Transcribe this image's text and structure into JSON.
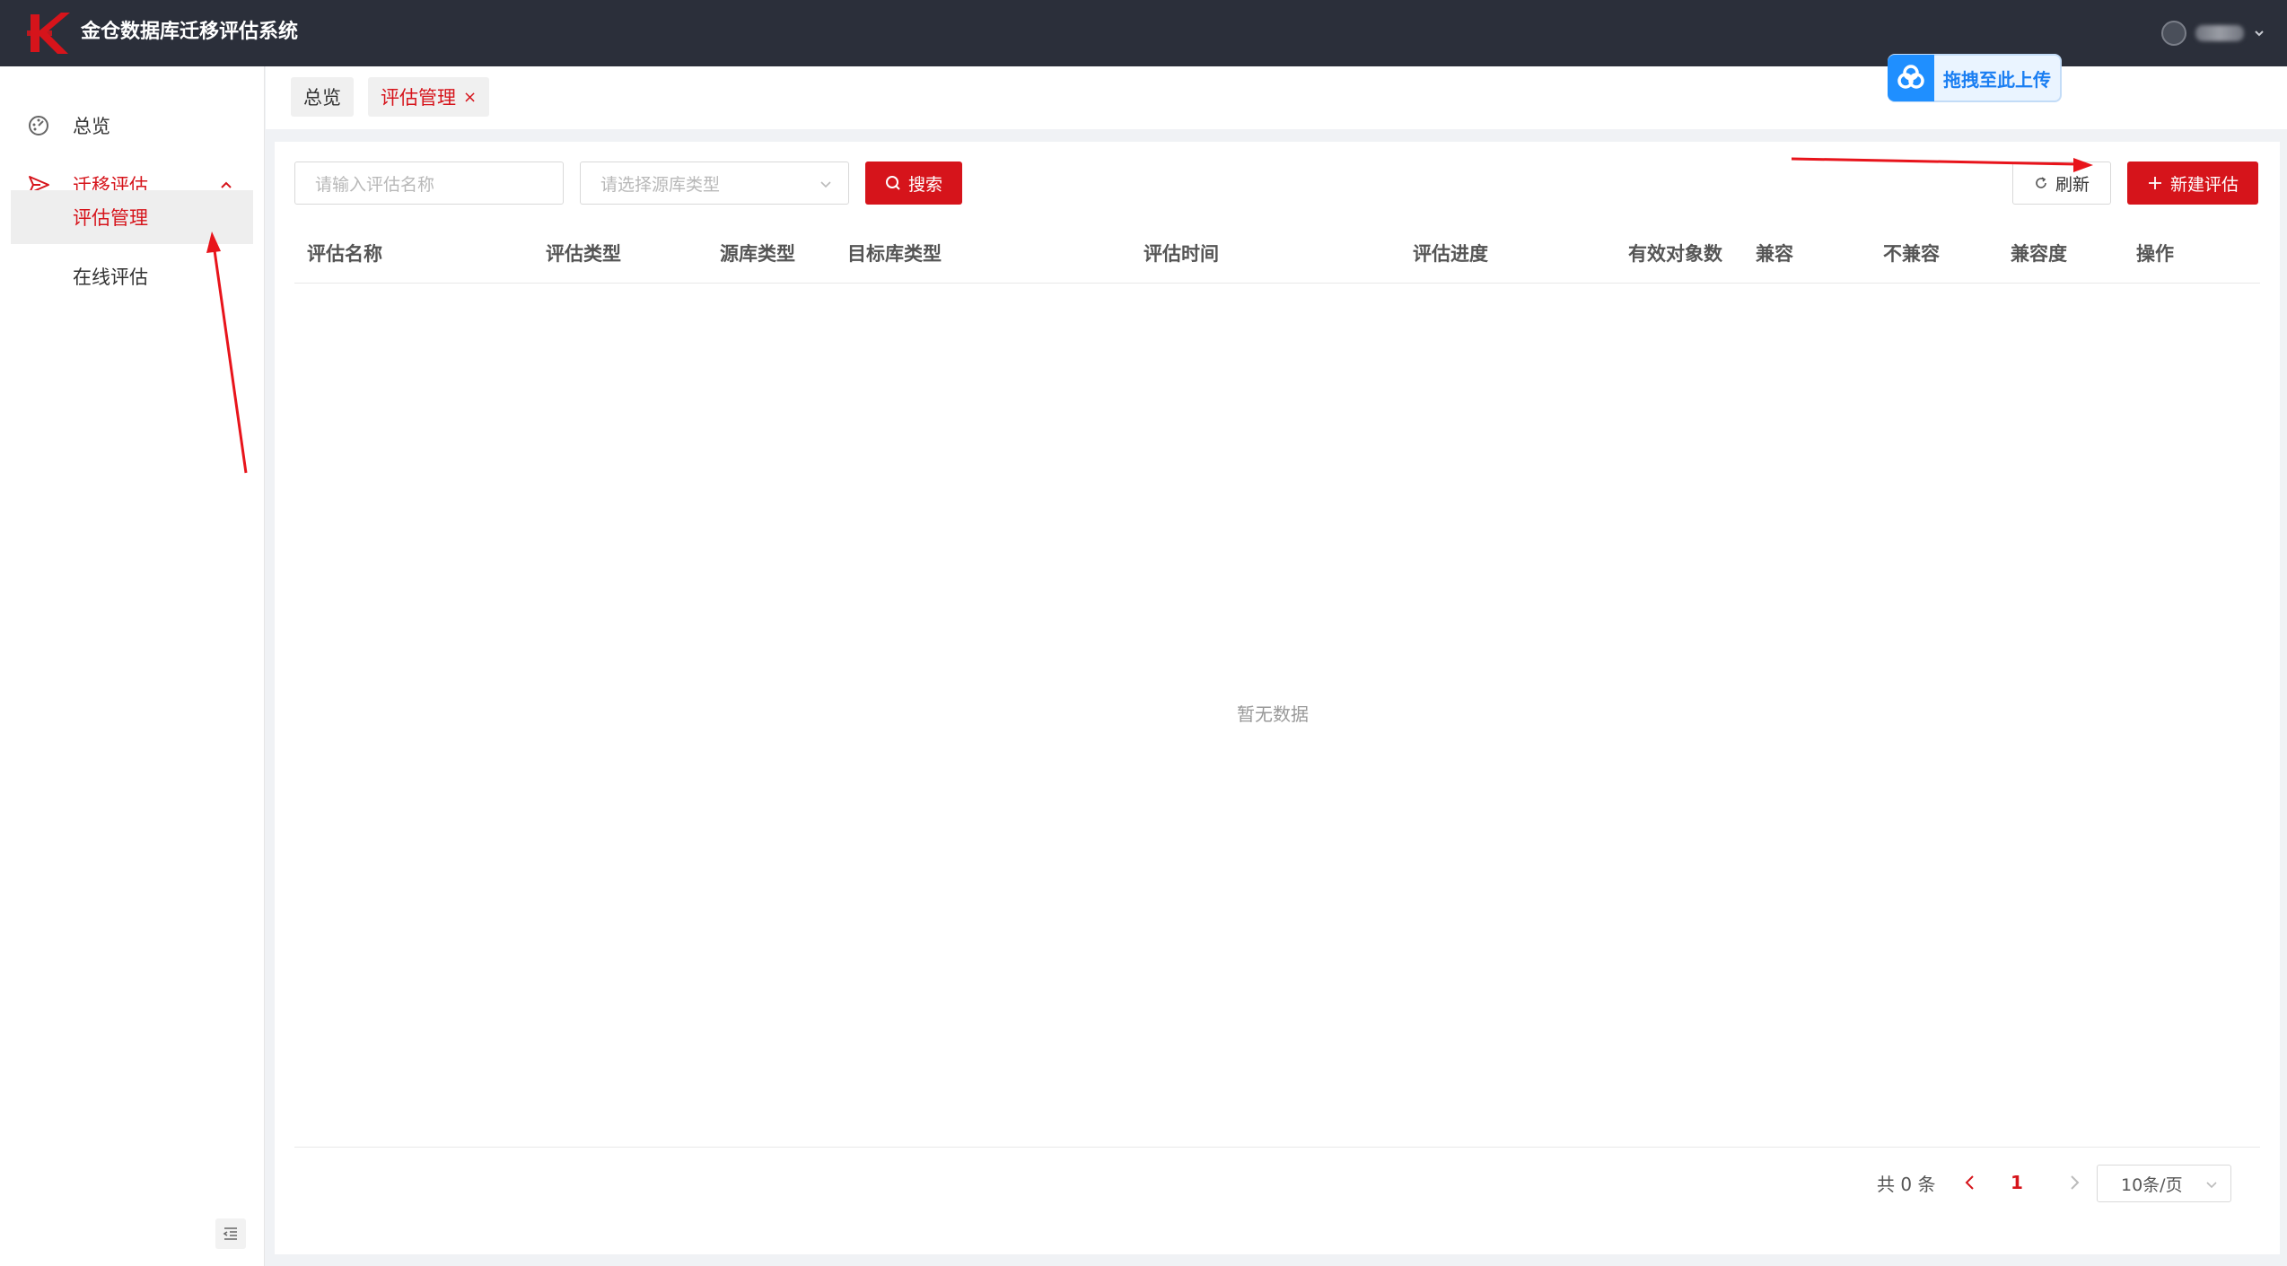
{
  "app": {
    "title": "金仓数据库迁移评估系统"
  },
  "sidebar": {
    "items": [
      {
        "label": "总览",
        "icon": "dashboard-icon"
      },
      {
        "label": "迁移评估",
        "icon": "send-icon",
        "expanded": true
      }
    ],
    "subitems": [
      {
        "label": "评估管理",
        "active": true
      },
      {
        "label": "在线评估",
        "active": false
      }
    ]
  },
  "tabs": [
    {
      "label": "总览"
    },
    {
      "label": "评估管理",
      "close": "×",
      "active": true
    }
  ],
  "upload_badge": {
    "label": "拖拽至此上传"
  },
  "filters": {
    "name_placeholder": "请输入评估名称",
    "source_placeholder": "请选择源库类型"
  },
  "buttons": {
    "search": "搜索",
    "refresh": "刷新",
    "new": "新建评估"
  },
  "table": {
    "columns": [
      "评估名称",
      "评估类型",
      "源库类型",
      "目标库类型",
      "评估时间",
      "评估进度",
      "有效对象数",
      "兼容",
      "不兼容",
      "兼容度",
      "操作"
    ],
    "rows": [],
    "empty_text": "暂无数据"
  },
  "pagination": {
    "total_text": "共 0 条",
    "current_page": "1",
    "page_size": "10条/页"
  },
  "colors": {
    "brand_red": "#d6141b",
    "topbar": "#2b2f3a",
    "upload_blue": "#1f8fff"
  }
}
